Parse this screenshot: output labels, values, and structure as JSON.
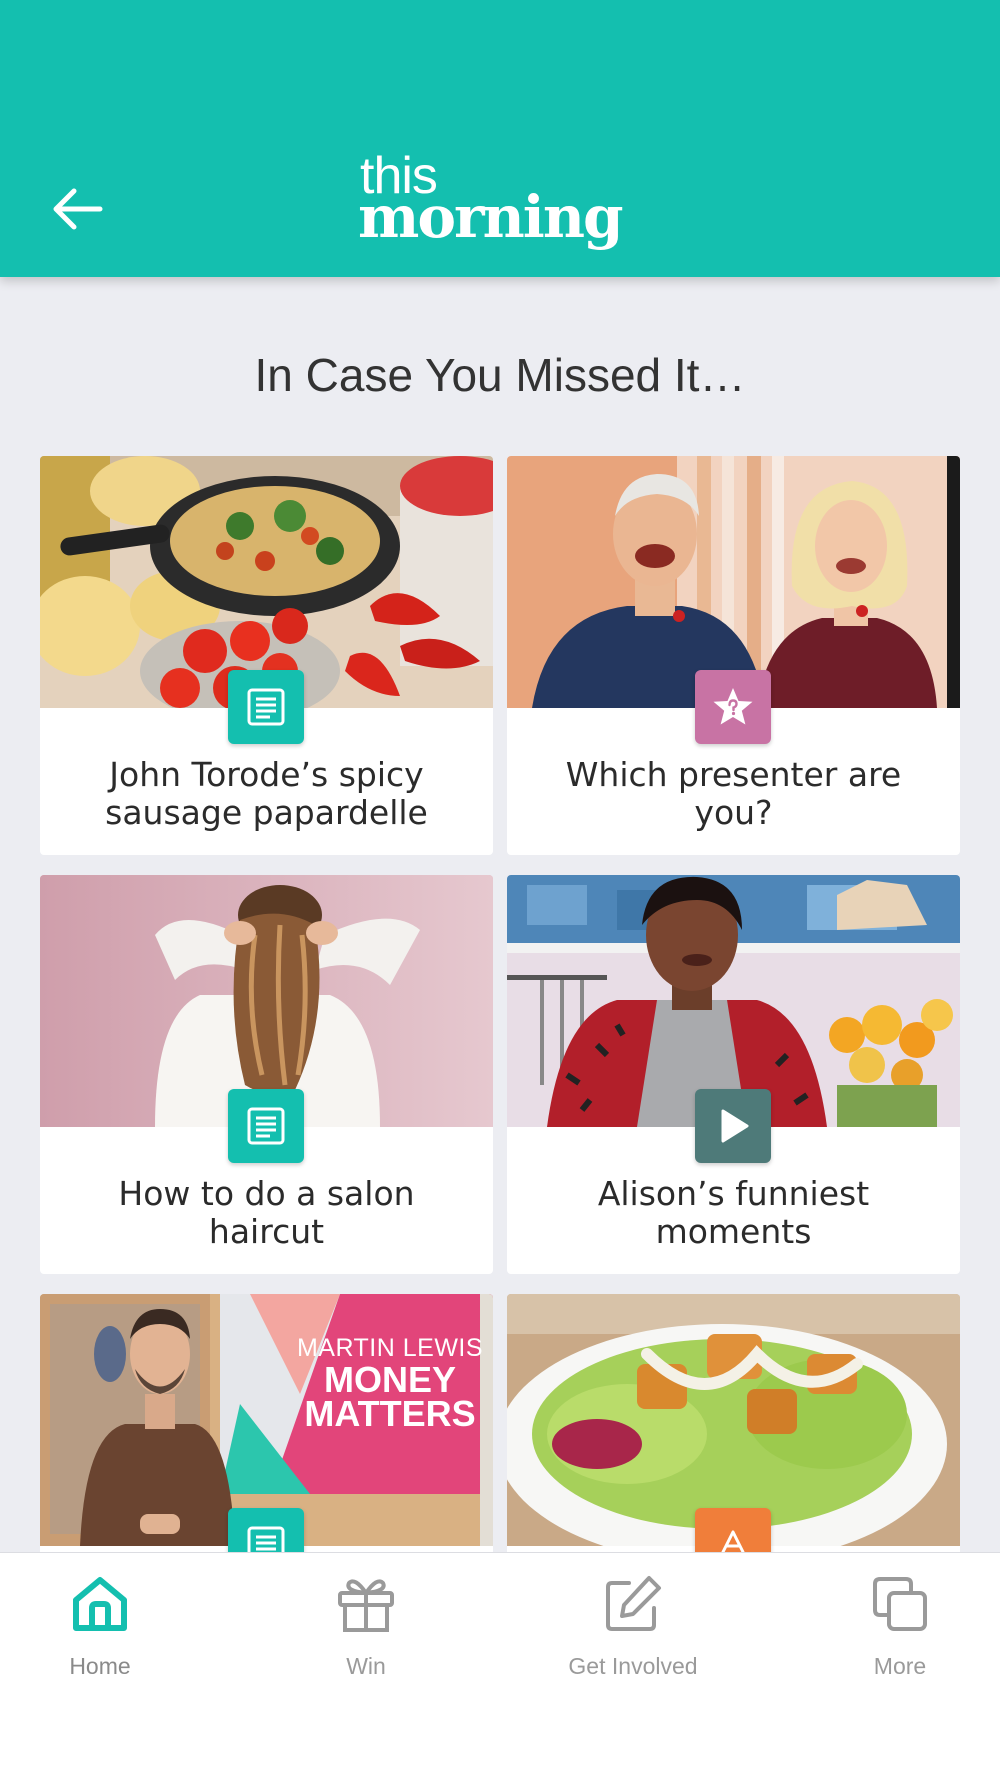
{
  "header": {
    "logo_line1": "this",
    "logo_line2": "morning",
    "back_icon": "arrow-left-icon",
    "brand_color": "#14bfaf"
  },
  "section_title": "In Case You Missed It…",
  "cards": [
    {
      "title": "John Torode’s spicy sausage papardelle",
      "badge": "article-icon",
      "badge_color": "#14bfaf"
    },
    {
      "title": "Which presenter are you?",
      "badge": "quiz-star-icon",
      "badge_color": "#c873a4"
    },
    {
      "title": "How to do a salon haircut",
      "badge": "article-icon",
      "badge_color": "#14bfaf"
    },
    {
      "title": "Alison’s funniest moments",
      "badge": "play-icon",
      "badge_color": "#4e7a79"
    },
    {
      "image_text_1": "MARTIN LEWIS",
      "image_text_2": "MONEY",
      "image_text_3": "MATTERS",
      "badge": "article-icon",
      "badge_color": "#14bfaf"
    },
    {
      "badge": "recipe-icon",
      "badge_color": "#f07e3a"
    }
  ],
  "tabs": [
    {
      "label": "Home",
      "icon": "home-icon",
      "active": true
    },
    {
      "label": "Win",
      "icon": "gift-icon",
      "active": false
    },
    {
      "label": "Get Involved",
      "icon": "edit-icon",
      "active": false
    },
    {
      "label": "More",
      "icon": "copy-icon",
      "active": false
    }
  ]
}
